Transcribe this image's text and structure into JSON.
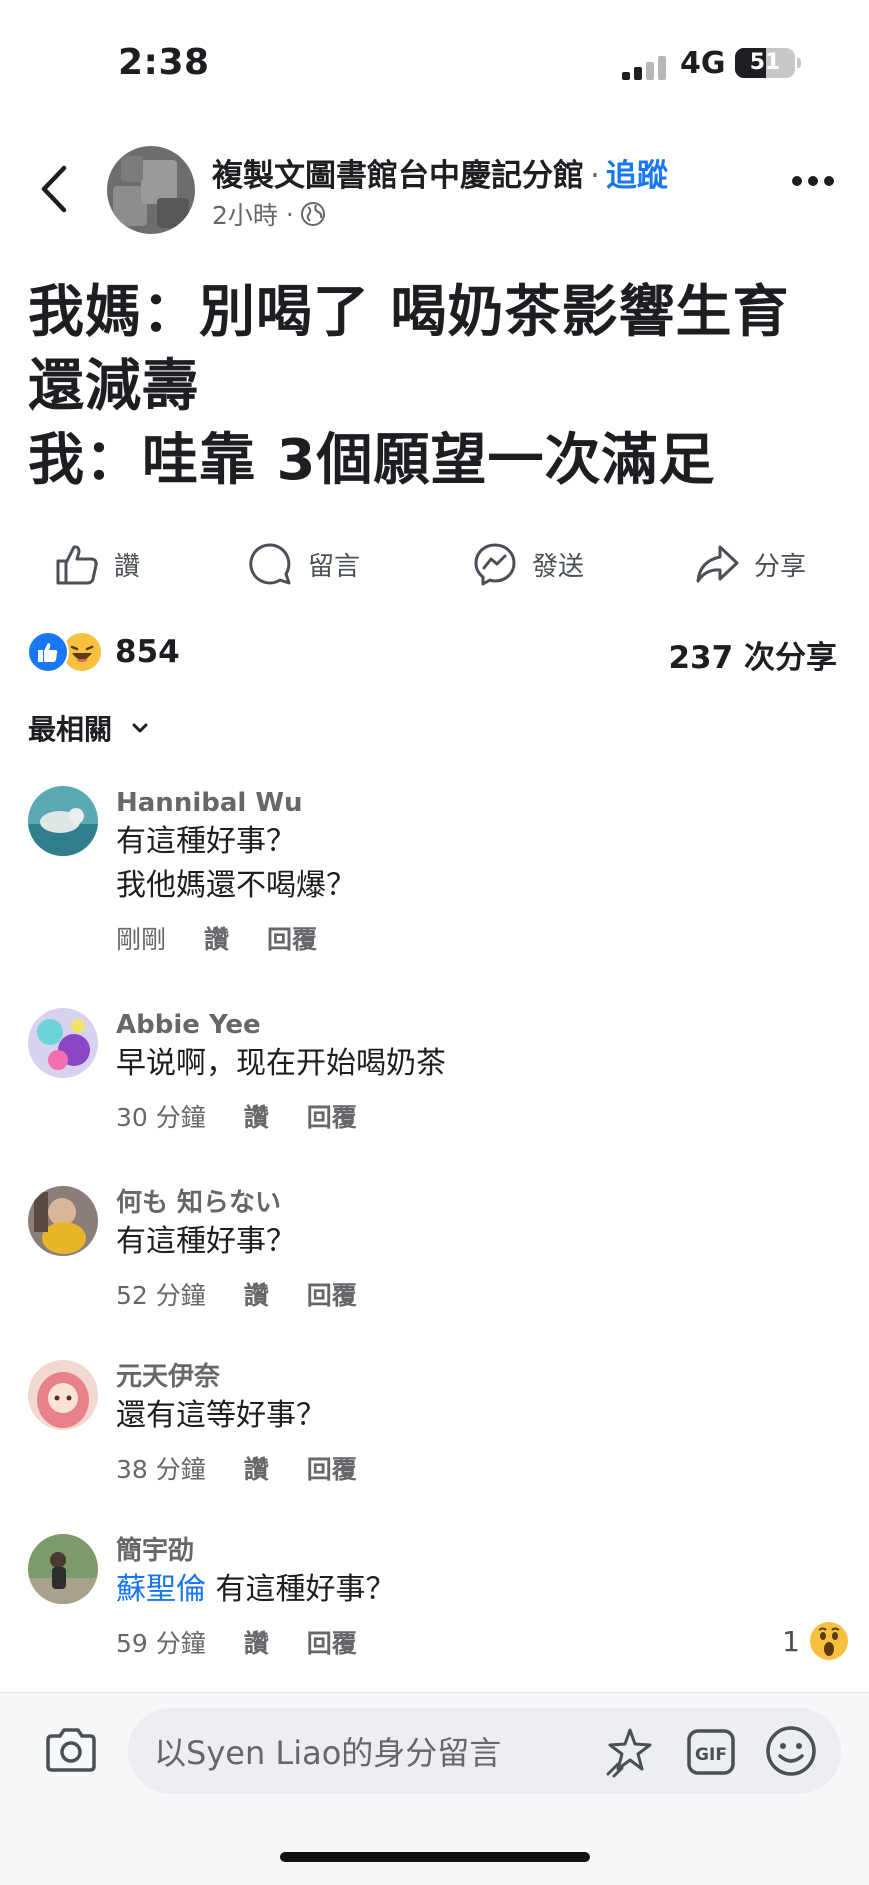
{
  "status_bar": {
    "time": "2:38",
    "network": "4G",
    "battery": "51",
    "battery_level": 0.51
  },
  "header": {
    "page_name": "複製文圖書館台中慶記分館",
    "follow_label": "追蹤",
    "time_ago": "2小時",
    "visibility_icon": "globe-icon"
  },
  "post": {
    "text": "我媽：別喝了 喝奶茶影響生育\n還減壽\n我：哇靠 3個願望一次滿足"
  },
  "actions": {
    "like": "讚",
    "comment": "留言",
    "send": "發送",
    "share": "分享"
  },
  "reactions": {
    "count": "854",
    "types": [
      "like",
      "haha"
    ],
    "shares": "237 次分享"
  },
  "sort": {
    "label": "最相關"
  },
  "comments": [
    {
      "name": "Hannibal Wu",
      "text": "有這種好事？\n我他媽還不喝爆？",
      "time": "剛剛",
      "like": "讚",
      "reply": "回覆"
    },
    {
      "name": "Abbie Yee",
      "text": "早说啊，现在开始喝奶茶",
      "time": "30 分鐘",
      "like": "讚",
      "reply": "回覆"
    },
    {
      "name": "何も 知らない",
      "text": "有這種好事？",
      "time": "52 分鐘",
      "like": "讚",
      "reply": "回覆"
    },
    {
      "name": "元天伊奈",
      "text": "還有這等好事？",
      "time": "38 分鐘",
      "like": "讚",
      "reply": "回覆"
    },
    {
      "name": "簡宇劭",
      "mention": "蘇聖倫",
      "text": "有這種好事？",
      "time": "59 分鐘",
      "like": "讚",
      "reply": "回覆",
      "reaction_count": "1",
      "reaction": "wow"
    }
  ],
  "composer": {
    "placeholder": "以Syen  Liao的身分留言"
  },
  "colors": {
    "accent": "#1877f2",
    "secondary_text": "#65676b",
    "reaction_yellow": "#f7c13f"
  }
}
